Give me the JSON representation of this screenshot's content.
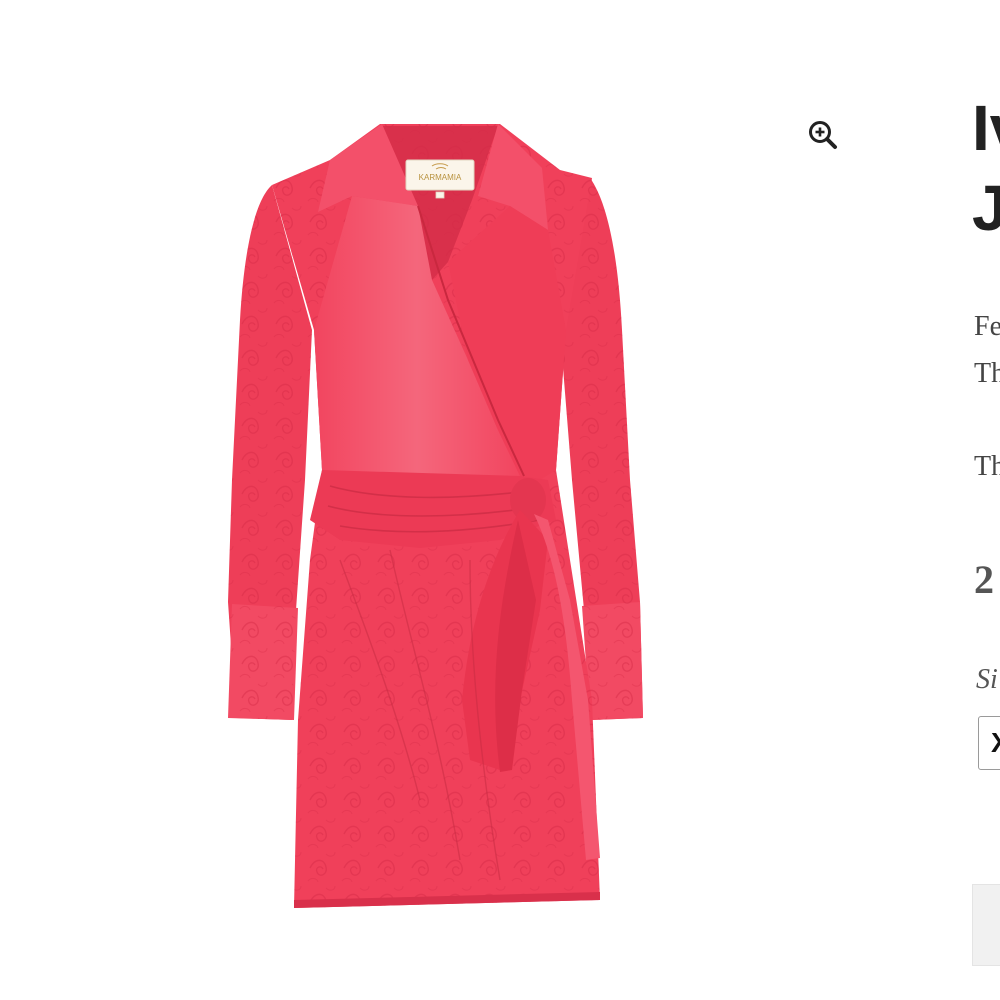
{
  "product": {
    "title_line_1": "Iv",
    "title_line_2": "J",
    "description_line_1": "Fe",
    "description_line_2": "Th",
    "description_line_3": "Th",
    "price": "2",
    "size_label": "Si",
    "selected_size": "X",
    "brand_tag": "KARMAMIA",
    "image_alt": "Pink jacquard wrap shirt dress with long sleeves and side tie"
  },
  "gallery": {
    "zoom_icon": "zoom-in-icon"
  },
  "colors": {
    "dress": "#f0405a",
    "title": "#222222",
    "body_text": "#444444",
    "button_bg": "#f1f1f1"
  }
}
